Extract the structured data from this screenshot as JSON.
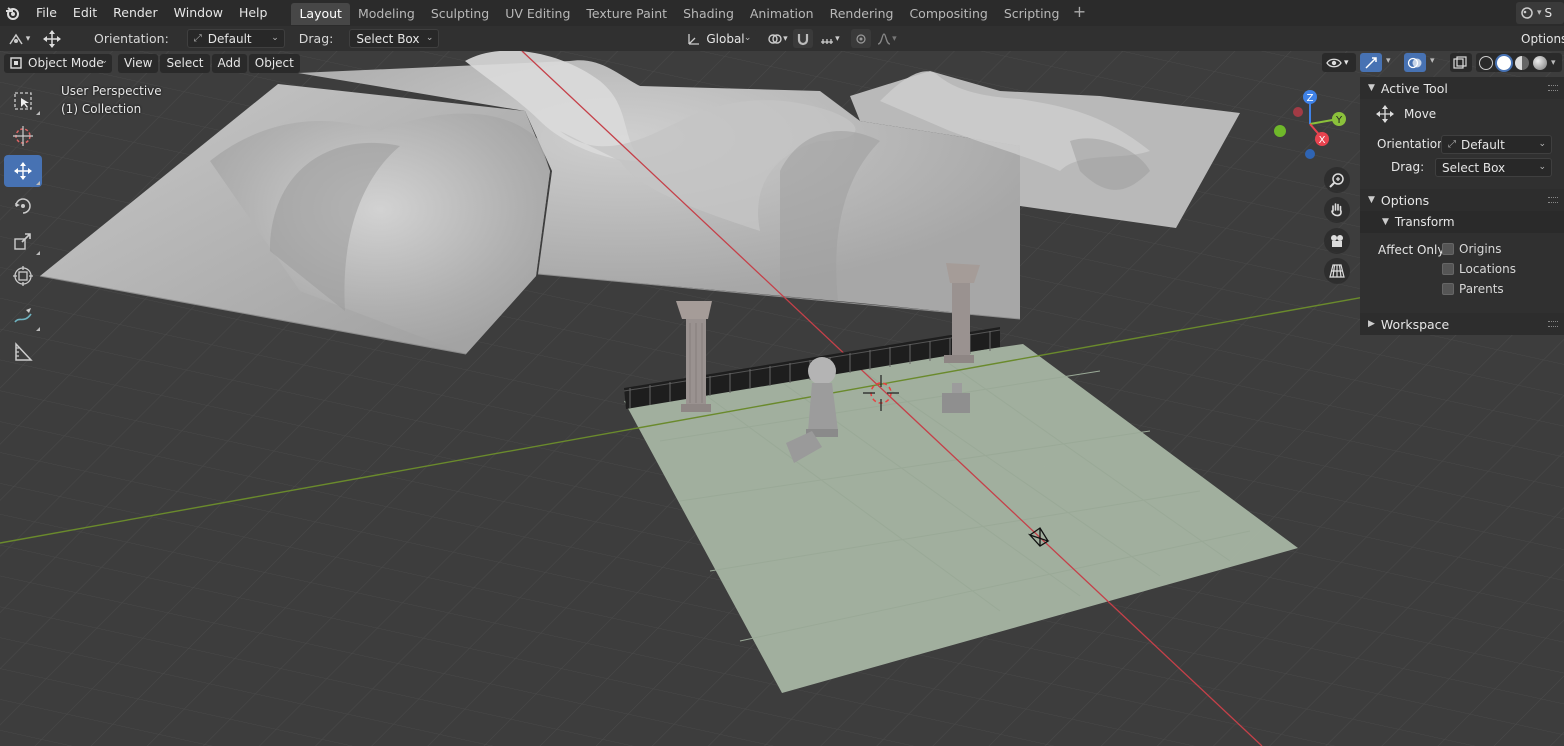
{
  "menubar": {
    "items": [
      "File",
      "Edit",
      "Render",
      "Window",
      "Help"
    ],
    "tabs": [
      "Layout",
      "Modeling",
      "Sculpting",
      "UV Editing",
      "Texture Paint",
      "Shading",
      "Animation",
      "Rendering",
      "Compositing",
      "Scripting"
    ],
    "active_tab": "Layout",
    "add_tab": "+",
    "scene_partial": "S"
  },
  "tool_header": {
    "orientation_label": "Orientation:",
    "orientation_value": "Default",
    "drag_label": "Drag:",
    "drag_value": "Select Box",
    "transform_orientation": "Global",
    "options_label": "Options"
  },
  "viewport_header": {
    "mode": "Object Mode",
    "menus": [
      "View",
      "Select",
      "Add",
      "Object"
    ]
  },
  "viewport": {
    "perspective_label": "User Perspective",
    "collection_label": "(1) Collection"
  },
  "gizmo": {
    "x": "X",
    "y": "Y",
    "z": "Z"
  },
  "side_panel": {
    "active_tool_title": "Active Tool",
    "tool_name": "Move",
    "orientation_label": "Orientation",
    "orientation_value": "Default",
    "drag_label": "Drag:",
    "drag_value": "Select Box",
    "options_title": "Options",
    "transform_title": "Transform",
    "affect_only_label": "Affect Only",
    "affect_options": [
      "Origins",
      "Locations",
      "Parents"
    ],
    "workspace_title": "Workspace"
  },
  "colors": {
    "accent": "#4772b3",
    "x_axis": "#e8434f",
    "y_axis": "#8bc13b",
    "z_axis": "#3f82e8",
    "ground_plane": "#a9b8a6"
  }
}
